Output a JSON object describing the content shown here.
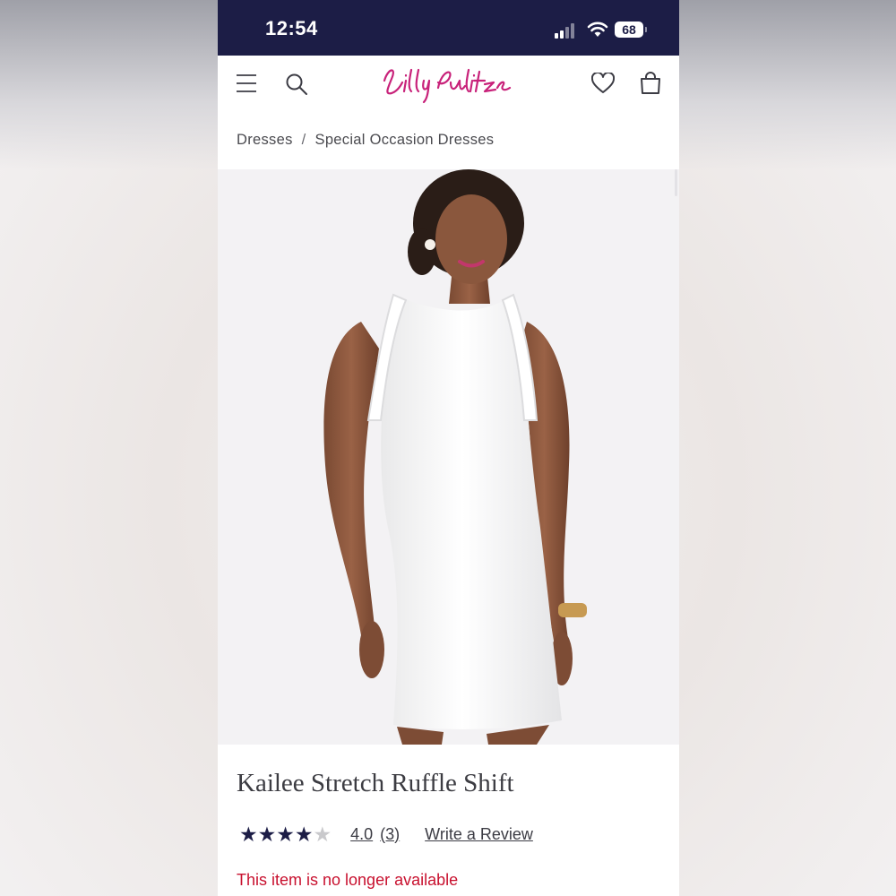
{
  "status_bar": {
    "time": "12:54",
    "battery": "68"
  },
  "header": {
    "brand": "Lilly Pulitzer",
    "icons": [
      "menu-icon",
      "search-icon",
      "heart-icon",
      "bag-icon"
    ]
  },
  "breadcrumb": {
    "items": [
      "Dresses",
      "Special Occasion Dresses"
    ],
    "separator": "/"
  },
  "product": {
    "title": "Kailee Stretch Ruffle Shift",
    "rating": {
      "stars_filled": 4,
      "stars_total": 5,
      "value": "4.0",
      "count": "(3)",
      "write_review": "Write a Review"
    },
    "availability": "This item is no longer available"
  },
  "colors": {
    "navy": "#1c1d46",
    "brand_pink": "#c8227a",
    "alert_red": "#c8102e"
  }
}
